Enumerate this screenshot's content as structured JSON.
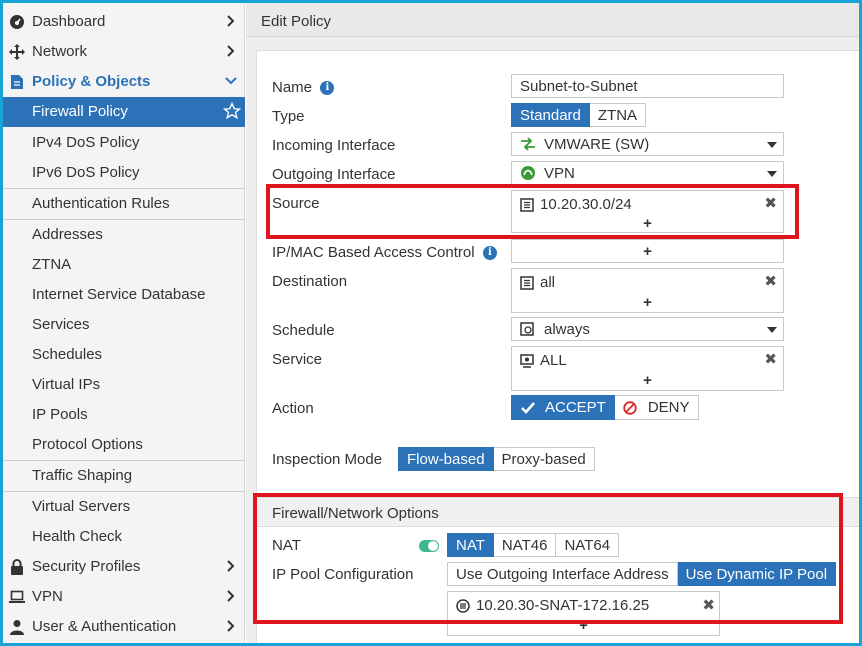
{
  "sidebar": {
    "items": [
      {
        "label": "Dashboard",
        "icon": "dashboard-icon",
        "chevron": "›"
      },
      {
        "label": "Network",
        "icon": "network-icon",
        "chevron": "›"
      },
      {
        "label": "Policy & Objects",
        "icon": "policy-icon",
        "chevron": "⌄"
      },
      {
        "label": "Firewall Policy",
        "icon": "star-icon"
      },
      {
        "label": "IPv4 DoS Policy"
      },
      {
        "label": "IPv6 DoS Policy"
      },
      {
        "label": "Authentication Rules"
      },
      {
        "label": "Addresses"
      },
      {
        "label": "ZTNA"
      },
      {
        "label": "Internet Service Database"
      },
      {
        "label": "Services"
      },
      {
        "label": "Schedules"
      },
      {
        "label": "Virtual IPs"
      },
      {
        "label": "IP Pools"
      },
      {
        "label": "Protocol Options"
      },
      {
        "label": "Traffic Shaping"
      },
      {
        "label": "Virtual Servers"
      },
      {
        "label": "Health Check"
      },
      {
        "label": "Security Profiles",
        "icon": "lock-icon",
        "chevron": "›"
      },
      {
        "label": "VPN",
        "icon": "laptop-icon",
        "chevron": "›"
      },
      {
        "label": "User & Authentication",
        "icon": "user-icon",
        "chevron": "›"
      }
    ]
  },
  "header": {
    "title": "Edit Policy"
  },
  "form": {
    "name_label": "Name",
    "name_value": "Subnet-to-Subnet",
    "type_label": "Type",
    "type_options": [
      "Standard",
      "ZTNA"
    ],
    "incoming_label": "Incoming Interface",
    "incoming_value": "VMWARE (SW)",
    "outgoing_label": "Outgoing Interface",
    "outgoing_value": "VPN",
    "source_label": "Source",
    "source_value": "10.20.30.0/24",
    "ipmac_label": "IP/MAC Based Access Control",
    "destination_label": "Destination",
    "destination_value": "all",
    "schedule_label": "Schedule",
    "schedule_value": "always",
    "service_label": "Service",
    "service_value": "ALL",
    "action_label": "Action",
    "action_accept": "ACCEPT",
    "action_deny": "DENY",
    "inspection_label": "Inspection Mode",
    "inspection_options": [
      "Flow-based",
      "Proxy-based"
    ],
    "plus": "+",
    "remove": "✖"
  },
  "network_options": {
    "title": "Firewall/Network Options",
    "nat_label": "NAT",
    "nat_options": [
      "NAT",
      "NAT46",
      "NAT64"
    ],
    "pool_label": "IP Pool Configuration",
    "pool_options": [
      "Use Outgoing Interface Address",
      "Use Dynamic IP Pool"
    ],
    "pool_value": "10.20.30-SNAT-172.16.25"
  },
  "colors": {
    "accent": "#2b72b8",
    "highlight": "#e0141e",
    "toggle_on": "#3fb68e",
    "frame": "#1aa3d6"
  }
}
